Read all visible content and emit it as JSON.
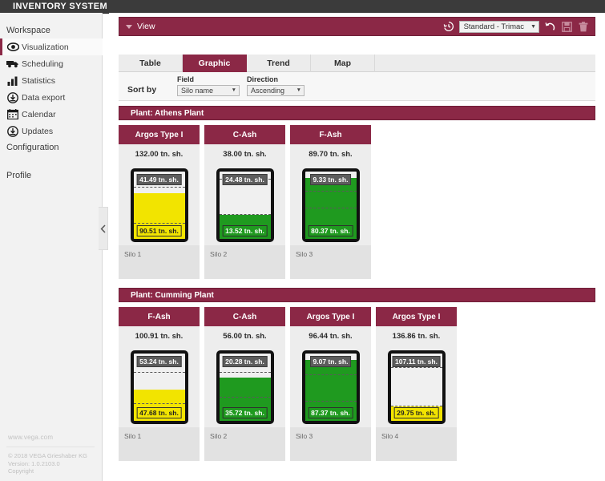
{
  "window": {
    "title": "INVENTORY SYSTEM"
  },
  "sidebar": {
    "section_workspace": "Workspace",
    "section_configuration": "Configuration",
    "section_profile": "Profile",
    "items": [
      {
        "label": "Visualization",
        "icon": "eye-icon",
        "active": true
      },
      {
        "label": "Scheduling",
        "icon": "truck-icon",
        "active": false
      },
      {
        "label": "Statistics",
        "icon": "bar-chart-icon",
        "active": false
      },
      {
        "label": "Data export",
        "icon": "download-circle-icon",
        "active": false
      },
      {
        "label": "Calendar",
        "icon": "calendar-icon",
        "active": false
      },
      {
        "label": "Updates",
        "icon": "download-circle-icon",
        "active": false
      }
    ],
    "footer": {
      "website": "www.vega.com",
      "copyright_line1": "© 2018 VEGA Grieshaber KG",
      "copyright_line2": "Version: 1.0.2103.0",
      "copyright_line3": "Copyright"
    },
    "collapse_icon": "chevron-left-icon"
  },
  "viewbar": {
    "caret_icon": "caret-down-icon",
    "label": "View",
    "history_icon": "clock-history-icon",
    "selected_view": "Standard - Trimac",
    "select_caret": "▼",
    "reset_icon": "undo-arrow-icon",
    "save_icon": "floppy-save-icon",
    "delete_icon": "trash-icon"
  },
  "tabs": [
    {
      "label": "Table",
      "active": false
    },
    {
      "label": "Graphic",
      "active": true
    },
    {
      "label": "Trend",
      "active": false
    },
    {
      "label": "Map",
      "active": false
    }
  ],
  "sort": {
    "label": "Sort by",
    "field": {
      "label": "Field",
      "value": "Silo name",
      "caret": "▼"
    },
    "direction": {
      "label": "Direction",
      "value": "Ascending",
      "caret": "▼"
    }
  },
  "units": "tn. sh.",
  "colors": {
    "brand": "#8b2846",
    "brand_dark": "#6f1f38",
    "fill_yellow": "#f2e400",
    "fill_green": "#1f9a1f",
    "empty": "#f0f0f0",
    "vessel_border": "#111111",
    "badge_top_bg": "#5d5d5d",
    "titlebar": "#3b3b3b"
  },
  "plants": [
    {
      "header": "Plant: Athens Plant",
      "silos": [
        {
          "product": "Argos Type I",
          "capacity": "132.00 tn. sh.",
          "empty_badge": "41.49 tn. sh.",
          "filled_badge": "90.51 tn. sh.",
          "fill_percent": 68,
          "fill_color": "yellow",
          "name": "Silo 1",
          "dash_levels": [
            23,
            76
          ]
        },
        {
          "product": "C-Ash",
          "capacity": "38.00 tn. sh.",
          "empty_badge": "24.48 tn. sh.",
          "filled_badge": "13.52 tn. sh.",
          "fill_percent": 36,
          "fill_color": "green",
          "name": "Silo 2",
          "dash_levels": [
            36,
            88
          ]
        },
        {
          "product": "F-Ash",
          "capacity": "89.70 tn. sh.",
          "empty_badge": "9.33 tn. sh.",
          "filled_badge": "80.37 tn. sh.",
          "fill_percent": 90,
          "fill_color": "green",
          "name": "Silo 3",
          "dash_levels": [
            45,
            70
          ]
        }
      ]
    },
    {
      "header": "Plant: Cumming Plant",
      "silos": [
        {
          "product": "F-Ash",
          "capacity": "100.91 tn. sh.",
          "empty_badge": "53.24 tn. sh.",
          "filled_badge": "47.68 tn. sh.",
          "fill_percent": 47,
          "fill_color": "yellow",
          "name": "Silo 1",
          "dash_levels": [
            25,
            72
          ]
        },
        {
          "product": "C-Ash",
          "capacity": "56.00 tn. sh.",
          "empty_badge": "20.28 tn. sh.",
          "filled_badge": "35.72 tn. sh.",
          "fill_percent": 64,
          "fill_color": "green",
          "name": "Silo 2",
          "dash_levels": [
            34,
            72
          ]
        },
        {
          "product": "Argos Type I",
          "capacity": "96.44 tn. sh.",
          "empty_badge": "9.07 tn. sh.",
          "filled_badge": "87.37 tn. sh.",
          "fill_percent": 91,
          "fill_color": "green",
          "name": "Silo 3",
          "dash_levels": [
            29,
            68
          ]
        },
        {
          "product": "Argos Type I",
          "capacity": "136.86 tn. sh.",
          "empty_badge": "107.11 tn. sh.",
          "filled_badge": "29.75 tn. sh.",
          "fill_percent": 22,
          "fill_color": "yellow",
          "name": "Silo 4",
          "dash_levels": [
            22,
            78
          ]
        }
      ]
    }
  ]
}
